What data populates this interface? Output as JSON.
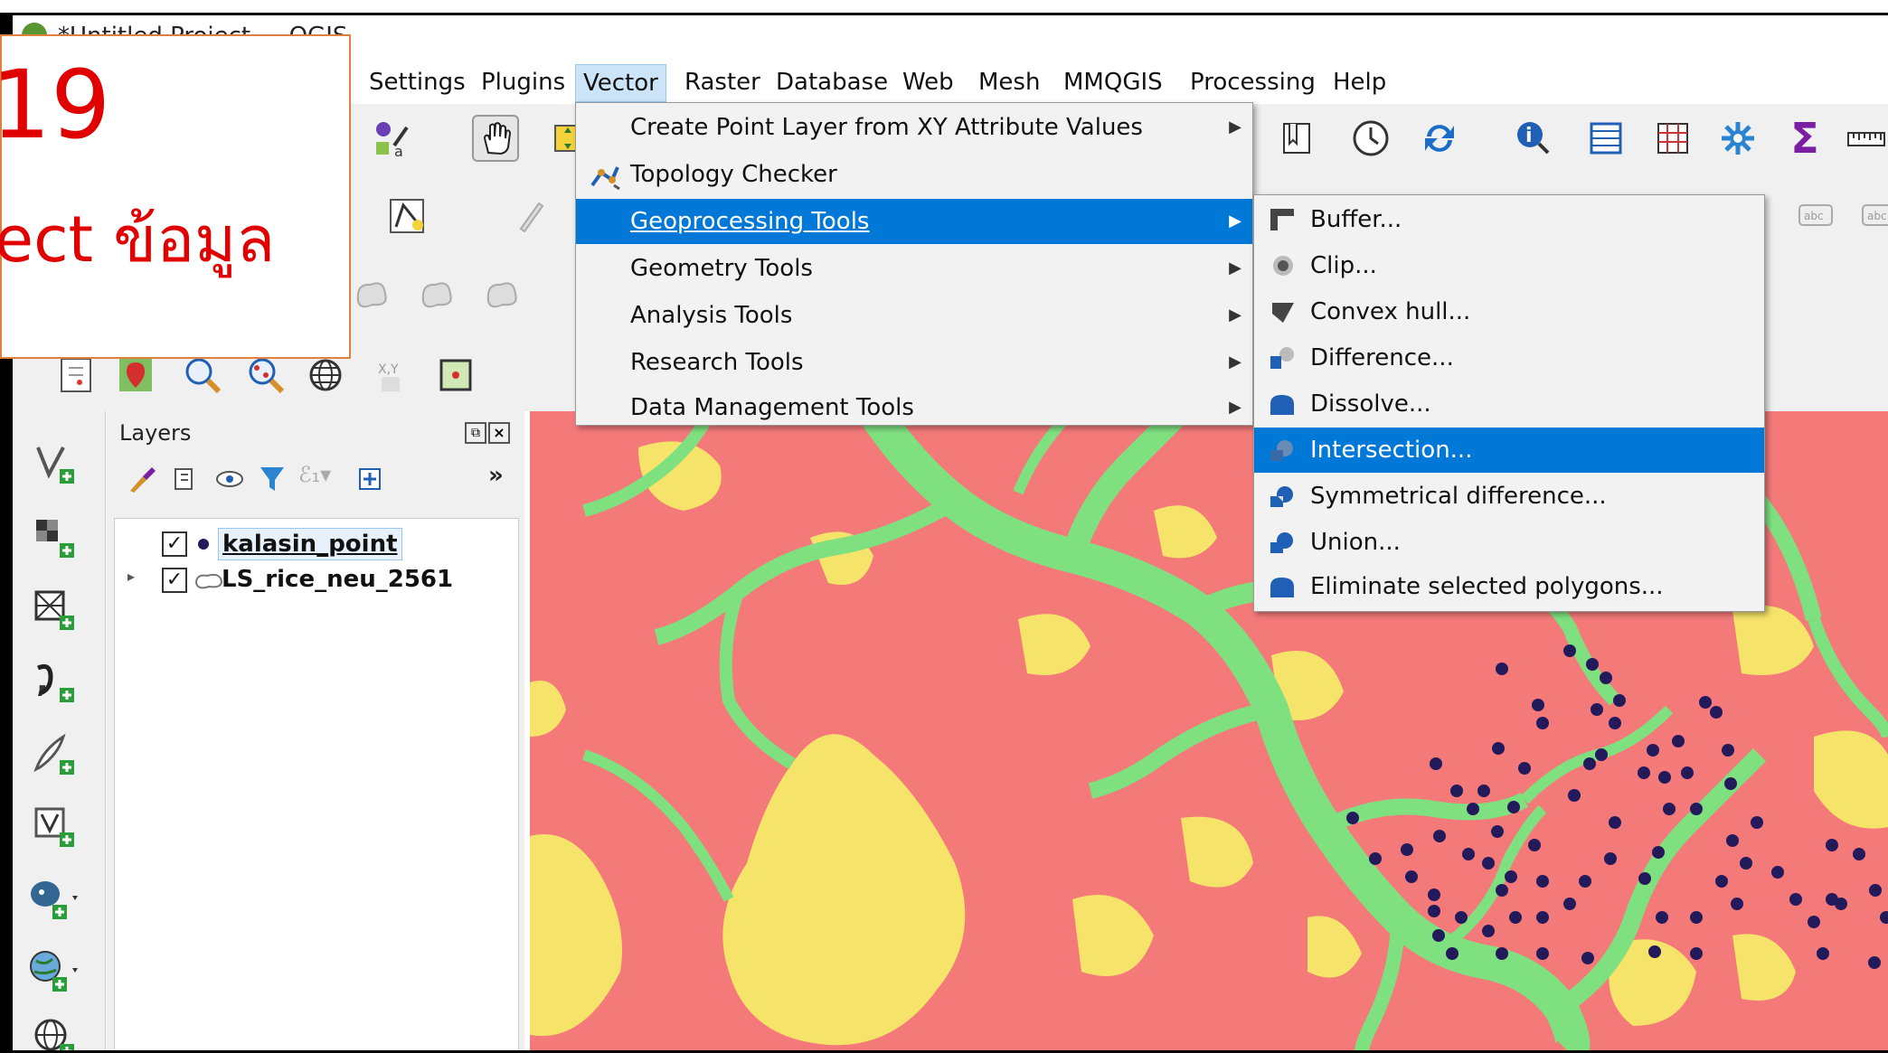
{
  "window": {
    "title": "*Untitled Project — QGIS"
  },
  "callout": {
    "number": "19",
    "text": "ect ข้อมูล"
  },
  "menubar": {
    "items": [
      "Settings",
      "Plugins",
      "Vector",
      "Raster",
      "Database",
      "Web",
      "Mesh",
      "MMQGIS",
      "Processing",
      "Help"
    ],
    "active": "Vector"
  },
  "vector_menu": {
    "items": [
      {
        "label": "Create Point Layer from XY Attribute Values",
        "submenu": true
      },
      {
        "label": "Topology Checker",
        "submenu": false,
        "icon": "topology-checker-icon"
      },
      {
        "label": "Geoprocessing Tools",
        "submenu": true,
        "highlighted": true
      },
      {
        "label": "Geometry Tools",
        "submenu": true
      },
      {
        "label": "Analysis Tools",
        "submenu": true
      },
      {
        "label": "Research Tools",
        "submenu": true
      },
      {
        "label": "Data Management Tools",
        "submenu": true
      }
    ]
  },
  "geoprocessing_menu": {
    "items": [
      {
        "label": "Buffer...",
        "icon": "buffer-icon"
      },
      {
        "label": "Clip...",
        "icon": "clip-icon"
      },
      {
        "label": "Convex hull...",
        "icon": "convex-hull-icon"
      },
      {
        "label": "Difference...",
        "icon": "difference-icon"
      },
      {
        "label": "Dissolve...",
        "icon": "dissolve-icon"
      },
      {
        "label": "Intersection...",
        "icon": "intersection-icon",
        "highlighted": true
      },
      {
        "label": "Symmetrical difference...",
        "icon": "symmetrical-difference-icon"
      },
      {
        "label": "Union...",
        "icon": "union-icon"
      },
      {
        "label": "Eliminate selected polygons...",
        "icon": "eliminate-icon"
      }
    ]
  },
  "layers_panel": {
    "title": "Layers",
    "layers": [
      {
        "name": "kalasin_point",
        "checked": true,
        "type": "point"
      },
      {
        "name": "LS_rice_neu_2561",
        "checked": true,
        "type": "polygon"
      }
    ],
    "more": "»"
  },
  "colors": {
    "map_red": "#f47a7a",
    "map_green": "#7fe07f",
    "map_yellow": "#f5e36a",
    "highlight": "#0078d7",
    "point": "#231a5c",
    "callout_text": "#e00000"
  }
}
